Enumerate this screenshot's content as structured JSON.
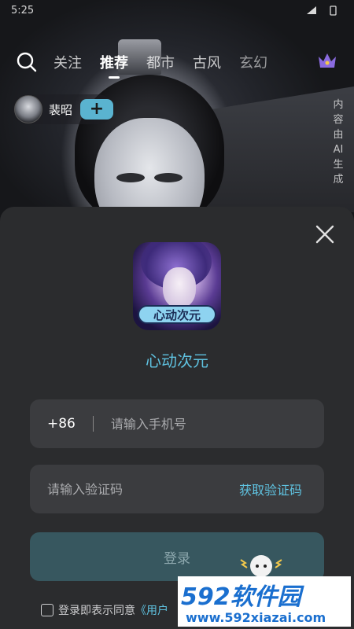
{
  "status_bar": {
    "time": "5:25"
  },
  "nav": {
    "tabs": [
      {
        "label": "关注",
        "state": "normal"
      },
      {
        "label": "推荐",
        "state": "active"
      },
      {
        "label": "都市",
        "state": "normal"
      },
      {
        "label": "古风",
        "state": "normal"
      },
      {
        "label": "玄幻",
        "state": "faded"
      }
    ]
  },
  "character": {
    "name": "裴昭",
    "add_label": "+"
  },
  "ai_notice": "内容由AI生成",
  "login": {
    "app_icon_text": "心动次元",
    "app_name": "心动次元",
    "country_code": "+86",
    "phone_placeholder": "请输入手机号",
    "code_placeholder": "请输入验证码",
    "get_code_label": "获取验证码",
    "submit_label": "登录",
    "agreement_text": "登录即表示同意",
    "agreement_link": "《用户"
  },
  "watermark": {
    "brand": "592软件园",
    "url": "www.592xiazai.com"
  },
  "colors": {
    "accent": "#5fc2e0",
    "sheet": "#2b2c2e",
    "field": "#3b3c3f",
    "button": "#37575f"
  }
}
